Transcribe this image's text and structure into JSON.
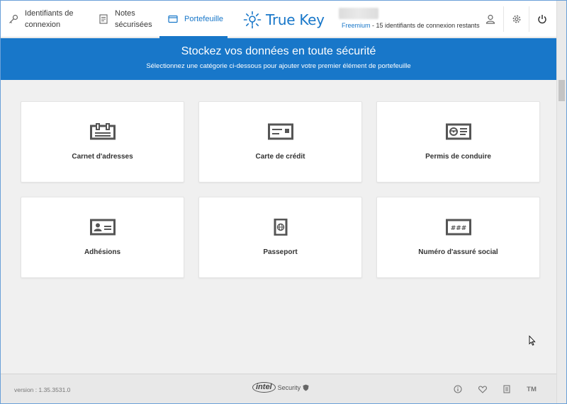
{
  "nav": {
    "logins_label_1": "Identifiants de",
    "logins_label_2": "connexion",
    "notes_label_1": "Notes",
    "notes_label_2": "sécurisées",
    "wallet_label": "Portefeuille",
    "brand": "True Key",
    "plan": "Freemium",
    "plan_detail": " - 15 identifiants de connexion restants"
  },
  "banner": {
    "title": "Stockez vos données en toute sécurité",
    "subtitle": "Sélectionnez une catégorie ci-dessous pour ajouter votre premier élément de portefeuille"
  },
  "categories": [
    {
      "label": "Carnet d'adresses",
      "icon": "address-book-icon"
    },
    {
      "label": "Carte de crédit",
      "icon": "credit-card-icon"
    },
    {
      "label": "Permis de conduire",
      "icon": "drivers-license-icon"
    },
    {
      "label": "Adhésions",
      "icon": "membership-card-icon"
    },
    {
      "label": "Passeport",
      "icon": "passport-icon"
    },
    {
      "label": "Numéro d'assuré social",
      "icon": "social-security-icon"
    }
  ],
  "footer": {
    "version": "version : 1.35.3531.0",
    "brand_word": "intel",
    "brand_sub": "Security",
    "tm": "TM"
  },
  "colors": {
    "accent": "#1877c9",
    "background": "#f0f0f0",
    "card": "#ffffff",
    "icon": "#555555"
  }
}
